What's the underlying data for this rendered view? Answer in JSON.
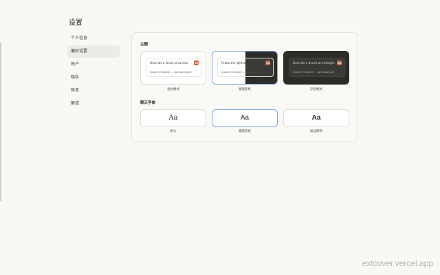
{
  "page": {
    "title": "设置"
  },
  "nav": {
    "items": [
      {
        "label": "个人信息"
      },
      {
        "label": "偏好设置"
      },
      {
        "label": "账户"
      },
      {
        "label": "隐私"
      },
      {
        "label": "账单"
      },
      {
        "label": "集成"
      }
    ],
    "active_index": 1
  },
  "theme": {
    "section_label": "主题",
    "cards": [
      {
        "prompt": "Describe a forest at sunrise.",
        "model": "Claude 3.5 Sonnet",
        "extra": "Choose style",
        "caption": "浅色模式"
      },
      {
        "prompt": "Follow the light wherever it leads.",
        "model": "Claude 3.5 Sonnet",
        "extra": "Choose style",
        "caption": "跟随系统"
      },
      {
        "prompt": "Describe a desert at midnight.",
        "model": "Claude 3.5 Sonnet",
        "extra": "Choose style",
        "caption": "深色模式"
      }
    ]
  },
  "font": {
    "section_label": "聊天字体",
    "cards": [
      {
        "sample": "Aa",
        "caption": "默认"
      },
      {
        "sample": "Aa",
        "caption": "跟随系统"
      },
      {
        "sample": "Aa",
        "caption": "阅读障碍"
      }
    ]
  },
  "watermark": "extcover.vercel.app",
  "colors": {
    "accent": "#c96442",
    "selected_border": "#7aa3e0",
    "dark_card": "#2d2c2a"
  }
}
